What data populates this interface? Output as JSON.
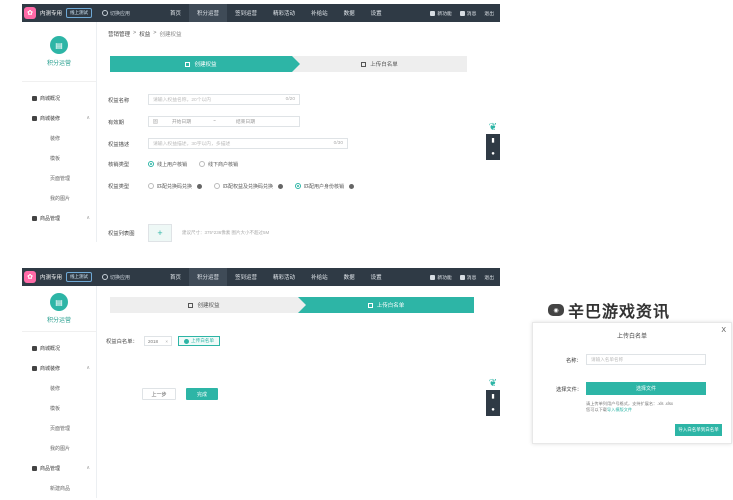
{
  "brand": {
    "name": "内测专用",
    "badge": "线上测试",
    "switch_label": "切换应用"
  },
  "nav": [
    "首页",
    "积分运营",
    "签到运营",
    "精彩活动",
    "补给站",
    "数据",
    "设置"
  ],
  "top_right": {
    "notice": "新功能",
    "message": "消息",
    "logout": "退出"
  },
  "sidebar": {
    "title": "积分运营",
    "items_top": [
      {
        "label": "商城概况",
        "type": "group"
      },
      {
        "label": "商城装修",
        "type": "group"
      },
      {
        "label": "装修",
        "type": "sub"
      },
      {
        "label": "模板",
        "type": "sub"
      },
      {
        "label": "页面管理",
        "type": "sub"
      },
      {
        "label": "我的图片",
        "type": "sub"
      },
      {
        "label": "商品管理",
        "type": "group"
      }
    ],
    "items_bottom": [
      {
        "label": "商城概况",
        "type": "group"
      },
      {
        "label": "商城装修",
        "type": "group"
      },
      {
        "label": "装修",
        "type": "sub"
      },
      {
        "label": "模板",
        "type": "sub"
      },
      {
        "label": "页面管理",
        "type": "sub"
      },
      {
        "label": "我的图片",
        "type": "sub"
      },
      {
        "label": "商品管理",
        "type": "group"
      },
      {
        "label": "新建商品",
        "type": "sub"
      }
    ]
  },
  "breadcrumb": {
    "a": "营销管理",
    "b": "权益",
    "c": "创建权益"
  },
  "steps": {
    "step1": "创建权益",
    "step2": "上传白名单"
  },
  "form": {
    "name_label": "权益名称",
    "name_placeholder": "请输入权益名称，20个以内",
    "name_count": "0/20",
    "valid_label": "有效期",
    "valid_prefix": "固",
    "valid_start": "开始日期",
    "valid_sep": "~",
    "valid_end": "结束日期",
    "desc_label": "权益描述",
    "desc_placeholder": "请输入权益描述，30字以内，多描述",
    "desc_count": "0/30",
    "verify_label": "核销类型",
    "verify_options": [
      "线上用户核销",
      "线下商户核销"
    ],
    "type_label": "权益类型",
    "type_options": [
      "匹配兑换码兑换",
      "匹配权益及兑换码兑换",
      "匹配用户身份核销"
    ],
    "image_label": "权益列表图",
    "image_hint": "建议尺寸：375*236像素 图片大小不超过5M"
  },
  "whitelist": {
    "label": "权益白名单：",
    "tag": "2018",
    "upload_button": "上传白名单"
  },
  "buttons": {
    "prev": "上一步",
    "finish": "完成"
  },
  "modal": {
    "title": "上传白名单",
    "close": "X",
    "name_label": "名称：",
    "name_placeholder": "请输入名单名称",
    "file_label": "选择文件：",
    "choose_button": "选择文件",
    "tip_line1": "请上传单列用户号格式，支持扩展名：.xls .xlsx",
    "tip_line2_prefix": "您可以下载",
    "tip_link": "导入模版文件",
    "import_button": "导入白名单到白名单"
  },
  "watermark": "辛巴游戏资讯",
  "colors": {
    "accent": "#2db5a6",
    "topbar": "#2f3a45"
  }
}
